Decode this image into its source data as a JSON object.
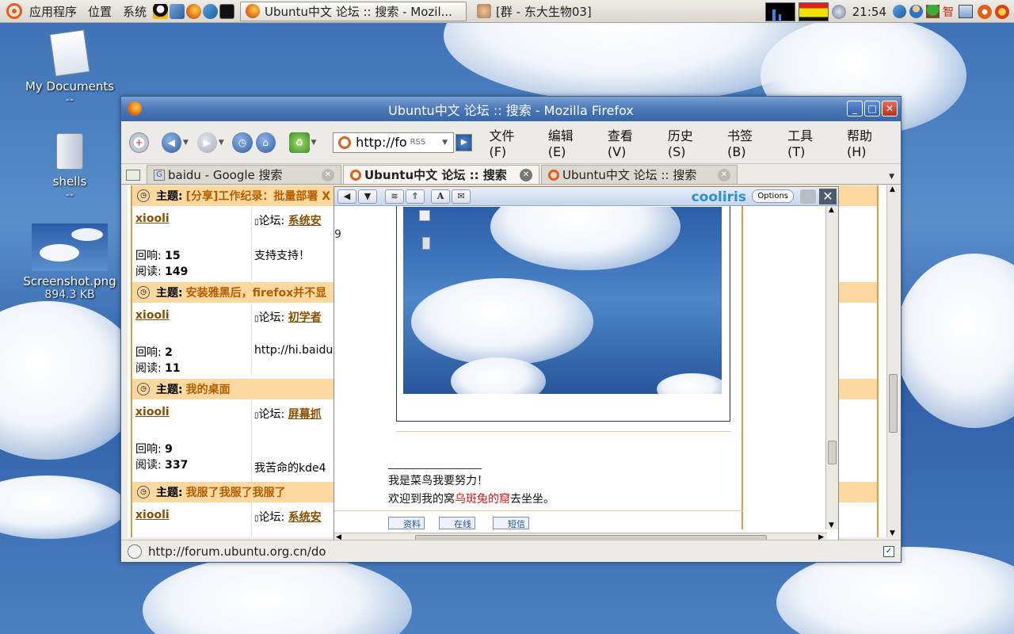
{
  "panel": {
    "menus": [
      "应用程序",
      "位置",
      "系统"
    ],
    "tasks": [
      {
        "label": "Ubuntu中文 论坛 :: 搜索 - Mozil...",
        "active": true
      },
      {
        "label": "[群 - 东大生物03]",
        "active": false
      }
    ],
    "clock": "21:54",
    "tray_text": "智"
  },
  "desktop": {
    "icons": [
      {
        "label": "My Documents",
        "sub": "--"
      },
      {
        "label": "shells",
        "sub": "--"
      },
      {
        "label": "Screenshot.png",
        "sub": "894.3 KB"
      }
    ]
  },
  "window": {
    "title": "Ubuntu中文 论坛 :: 搜索 - Mozilla Firefox",
    "url": "http://fo",
    "rss": "RSS",
    "menus": [
      "文件 (F)",
      "编辑 (E)",
      "查看 (V)",
      "历史 (S)",
      "书签 (B)",
      "工具 (T)",
      "帮助 (H)"
    ],
    "tabs": [
      {
        "label": "baidu - Google 搜索",
        "active": false
      },
      {
        "label": "Ubuntu中文 论坛 :: 搜索",
        "active": true
      },
      {
        "label": "Ubuntu中文 论坛 :: 搜索",
        "active": false
      }
    ],
    "status_url": "http://forum.ubuntu.org.cn/do"
  },
  "forum": {
    "topic_prefix": "主题:",
    "forum_prefix": "论坛:",
    "reply_label": "回响:",
    "read_label": "阅读:",
    "rows": [
      {
        "topic": "[分享]工作纪录：批量部署 X",
        "user": "xiooli",
        "replies": "15",
        "reads": "149",
        "forum": "系统安",
        "excerpt": "支持支持！"
      },
      {
        "topic": "安装雅黑后，firefox并不显",
        "user": "xiooli",
        "replies": "2",
        "reads": "11",
        "forum": "初学者",
        "excerpt": "http://hi.baidu"
      },
      {
        "topic": "我的桌面",
        "user": "xiooli",
        "replies": "9",
        "reads": "337",
        "forum": "屏幕抓",
        "excerpt": "我苦命的kde4"
      },
      {
        "topic": "我服了我服了我服了",
        "user": "xiooli",
        "replies": "",
        "reads": "",
        "forum": "系统安",
        "excerpt": ""
      }
    ]
  },
  "cooliris": {
    "logo": "cooliris",
    "options": "Options",
    "stray_char": "9",
    "signature": [
      "我是菜鸟我要努力！"
    ],
    "welcome_prefix": "欢迎到我的窝",
    "welcome_link": "乌斑兔的窟",
    "welcome_suffix": "去坐坐。",
    "actions": [
      "资料",
      "在线",
      "短信"
    ]
  },
  "colors": {
    "topic_bar": "#fbd89f",
    "link": "#8a4e00",
    "accent": "#e0601a"
  }
}
